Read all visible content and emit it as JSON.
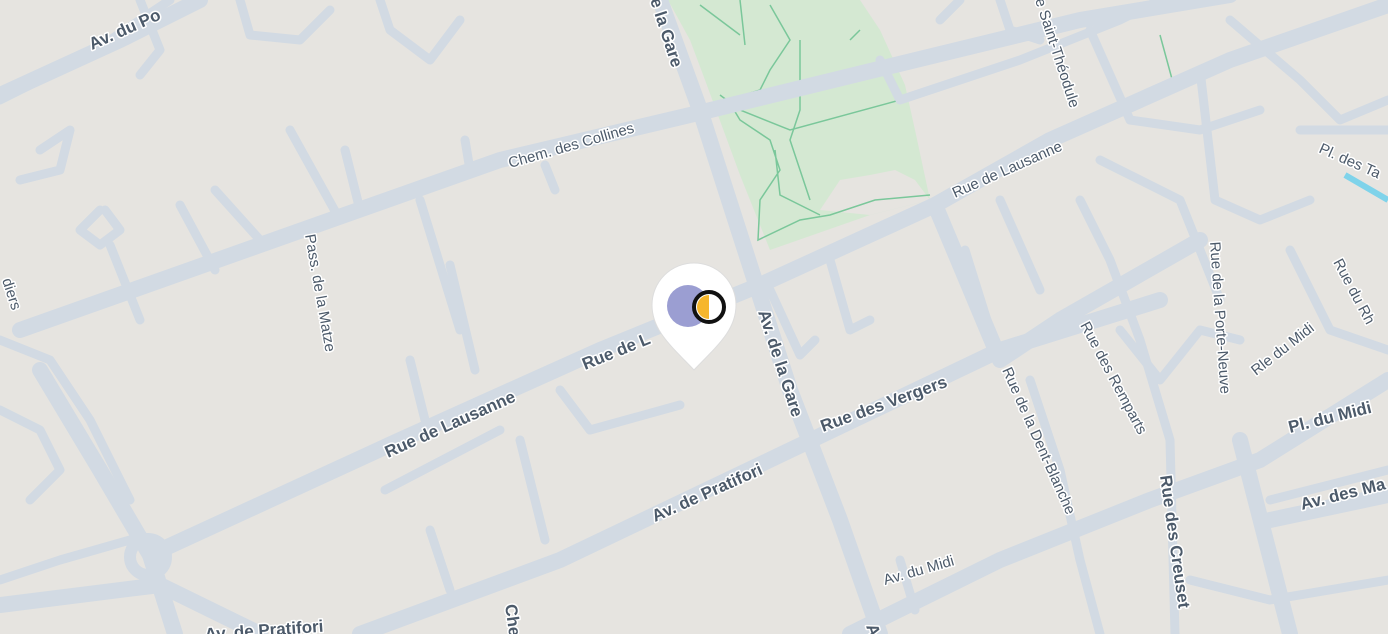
{
  "map": {
    "colors": {
      "land": "#e6e4e0",
      "street": "#d2dae3",
      "park": "#d4e8d2",
      "park_path": "#7ac79a",
      "water": "#7fd3ea",
      "label": "#4c5a6a",
      "marker_left": "#9b9ed2",
      "marker_right": "#f6b62c"
    },
    "labels": {
      "av_du_po": "Av. du Po",
      "rue_de_la_gare_top": "e la Gare",
      "chem_des_collines": "Chem. des Collines",
      "rue_saint_theodule": "e Saint-Théodule",
      "pl_des_ta": "Pl. des Ta",
      "rue_de_lausanne_east": "Rue de Lausanne",
      "pass_de_la_matze": "Pass. de la Matze",
      "diers": "diers",
      "rue_de_l": "Rue de L",
      "rue_de_lausanne_west": "Rue de Lausanne",
      "av_de_la_gare": "Av. de la Gare",
      "rue_des_vergers": "Rue des Vergers",
      "av_de_pratifori": "Av. de Pratifori",
      "av_de_pratifori_bottom": "Av. de Pratifori",
      "rue_de_la_dent_blanche": "Rue de la Dent-Blanche",
      "rue_des_remparts": "Rue des Remparts",
      "rue_de_la_porte_neuve": "Rue de la Porte-Neuve",
      "rle_du_midi": "Rle du Midi",
      "rue_du_rh": "Rue du Rh",
      "pl_du_midi": "Pl. du Midi",
      "av_des_ma": "Av. des Ma",
      "rue_des_creuset": "Rue des Creuset",
      "av_du_midi": "Av. du Midi",
      "che": "Che",
      "a_fragment": "A"
    },
    "marker": {
      "icon": "half-moon-location-pin"
    }
  }
}
